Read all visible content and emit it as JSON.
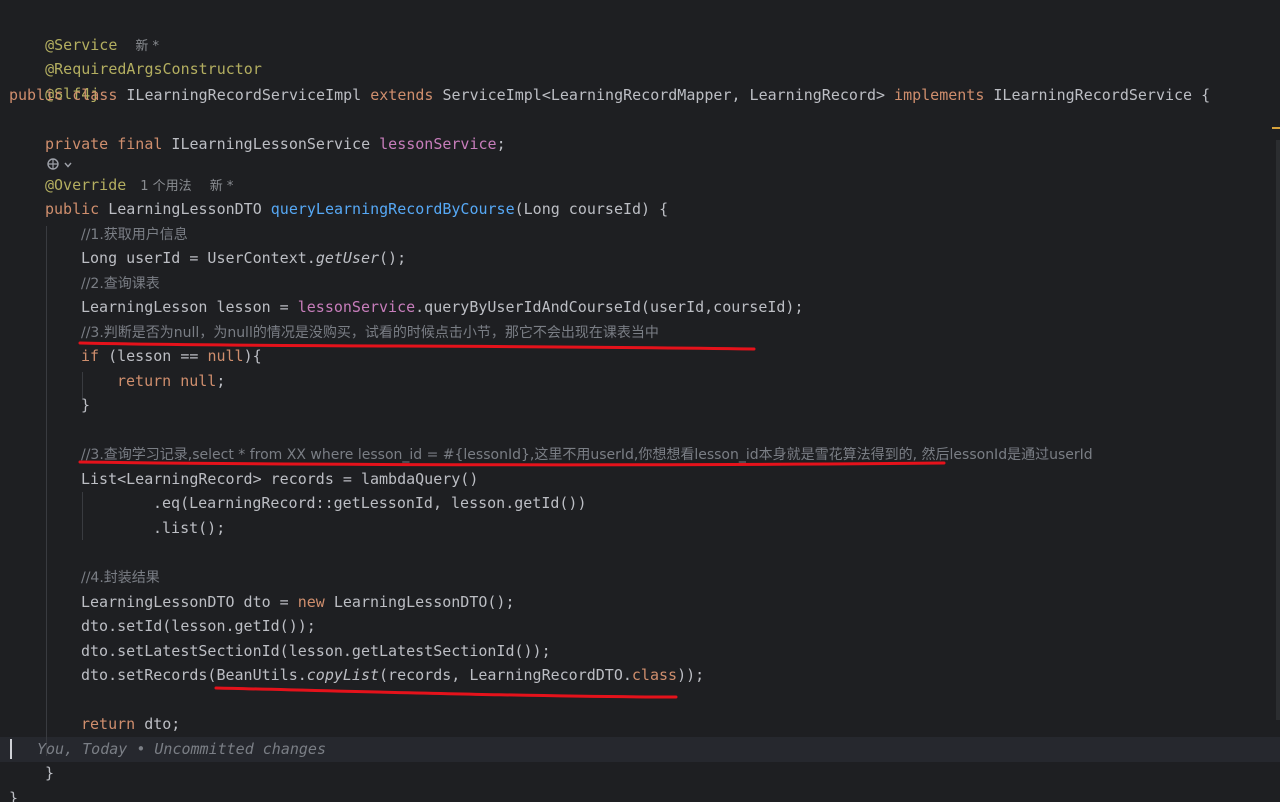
{
  "editor": {
    "line_annotation_service": "@Service",
    "hint_new": "新 *",
    "line_annotation_rac": "@RequiredArgsConstructor",
    "line_annotation_slf4j": "@Slf4j",
    "class_decl": {
      "kw_public": "public",
      "kw_class": "class",
      "class_name": " ILearningRecordServiceImpl ",
      "kw_extends": "extends",
      "super": " ServiceImpl<LearningRecordMapper, LearningRecord> ",
      "kw_implements": "implements",
      "iface": " ILearningRecordService {"
    },
    "field_decl": {
      "kw_private": "private",
      "kw_final": "final",
      "type": " ILearningLessonService ",
      "name": "lessonService",
      "end": ";"
    },
    "override": "@Override",
    "usages_hint": "1 个用法",
    "method_decl": {
      "kw_public": "public",
      "type": " LearningLessonDTO ",
      "name": "queryLearningRecordByCourse",
      "params": "(Long courseId) {"
    },
    "c1": "//1.获取用户信息",
    "l_user": {
      "pre": "Long userId = UserContext.",
      "call": "getUser",
      "post": "();"
    },
    "c2": "//2.查询课表",
    "l_lesson": {
      "pre": "LearningLesson lesson = ",
      "field": "lessonService",
      "post": ".queryByUserIdAndCourseId(userId,courseId);"
    },
    "c3a": "//3.判断是否为null，为null的情况是没购买，试看的时候点击小节，那它不会出现在课表当中",
    "l_if": {
      "kw_if": "if",
      "mid": " (lesson == ",
      "kw_null": "null",
      "post": "){"
    },
    "l_return_null": {
      "kw_return": "return",
      "kw_null": " null",
      "post": ";"
    },
    "close_brace": "}",
    "c3b": "//3.查询学习记录,select * from XX where lesson_id = #{lessonId},这里不用userId,你想想看lesson_id本身就是雪花算法得到的, 然后lessonId是通过userId",
    "l_list": "List<LearningRecord> records = lambdaQuery()",
    "l_eq": ".eq(LearningRecord::getLessonId, lesson.getId())",
    "l_listcall": ".list();",
    "c4": "//4.封装结果",
    "l_new": {
      "pre": "LearningLessonDTO dto = ",
      "kw_new": "new",
      "post": " LearningLessonDTO();"
    },
    "l_setid": "dto.setId(lesson.getId());",
    "l_setlatest": "dto.setLatestSectionId(lesson.getLatestSectionId());",
    "l_setrecords": {
      "pre": "dto.setRecords(BeanUtils.",
      "call": "copyList",
      "mid": "(records, LearningRecordDTO.",
      "kw_class": "class",
      "post": "));"
    },
    "l_return": {
      "kw_return": "return",
      "post": " dto;"
    },
    "blame": "You, Today • Uncommitted changes",
    "method_close": "}",
    "class_close": "}"
  },
  "colors": {
    "background": "#1e1f22",
    "keyword": "#cf8e6d",
    "annotation": "#b3ae60",
    "method": "#56a8f5",
    "field": "#c77dbb",
    "comment": "#7a7e85",
    "underline_marks": "#e5121b"
  },
  "icons": [
    "ai-gutter-icon",
    "chevron-down-icon"
  ]
}
